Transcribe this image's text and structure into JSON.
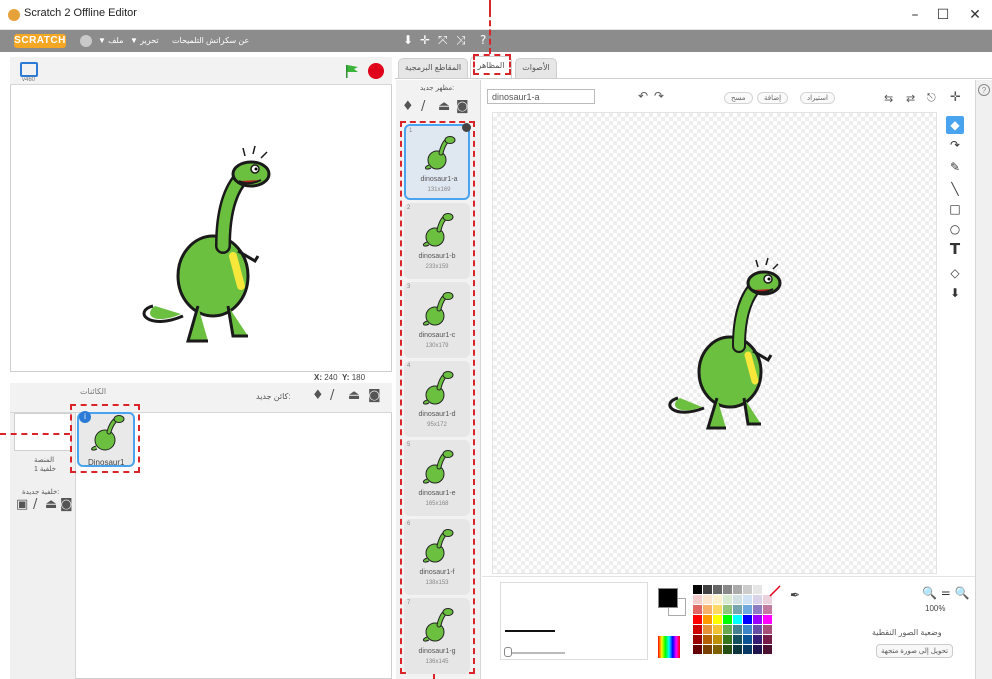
{
  "window": {
    "title": "Scratch 2 Offline Editor",
    "minimize": "–",
    "maximize": "☐",
    "close": "✕"
  },
  "menubar": {
    "logo": "SCRATCH",
    "items": [
      "▼ ملف",
      "▼ تحرير",
      "التلميحات",
      "عن سكراتش"
    ],
    "toolbar_icons": [
      "⬇",
      "✛",
      "⤧",
      "⤨",
      "?"
    ]
  },
  "stage": {
    "version": "v460",
    "coords_x": "240",
    "coords_y": "180",
    "x_label": "X:",
    "y_label": "Y:"
  },
  "sprites": {
    "title": "الكائنات",
    "new_sprite": "كائن جديد:",
    "stage_label": "المنصة",
    "backdrop_count": "خلفية 1",
    "new_backdrop": "خلفية جديدة:",
    "items": [
      {
        "name": "Dinosaur1",
        "info": "i"
      }
    ]
  },
  "tabs": [
    {
      "label": "المقاطع البرمجية",
      "active": false
    },
    {
      "label": "المظاهر",
      "active": true
    },
    {
      "label": "الأصوات",
      "active": false
    }
  ],
  "costumes": {
    "new_costume": "مظهر جديد:",
    "list": [
      {
        "num": "1",
        "name": "dinosaur1-a",
        "size": "131x169",
        "selected": true
      },
      {
        "num": "2",
        "name": "dinosaur1-b",
        "size": "233x159",
        "selected": false
      },
      {
        "num": "3",
        "name": "dinosaur1-c",
        "size": "130x179",
        "selected": false
      },
      {
        "num": "4",
        "name": "dinosaur1-d",
        "size": "95x172",
        "selected": false
      },
      {
        "num": "5",
        "name": "dinosaur1-e",
        "size": "165x168",
        "selected": false
      },
      {
        "num": "6",
        "name": "dinosaur1-f",
        "size": "138x153",
        "selected": false
      },
      {
        "num": "7",
        "name": "dinosaur1-g",
        "size": "136x145",
        "selected": false
      }
    ]
  },
  "paint": {
    "costume_name": "dinosaur1-a",
    "undo": "↶",
    "redo": "↷",
    "clear": "مسح",
    "add": "إضافة",
    "import": "استيراد",
    "zoom": "100%",
    "bitmap_mode": "وضعية الصور النقطية",
    "convert": "تحويل إلى صورة متجهة",
    "tools": [
      "◆",
      "↷",
      "✎",
      "╲",
      "□",
      "○",
      "T",
      "◇",
      "⬇"
    ],
    "top_tools": [
      "⇆",
      "⇄",
      "⎋",
      "✛"
    ]
  },
  "colors": {
    "primary": "#000000",
    "secondary": "#ffffff",
    "accent": "#4aa3ef",
    "highlight": "#d9252a",
    "palette": [
      "#000000",
      "#404040",
      "#666666",
      "#888888",
      "#aaaaaa",
      "#cccccc",
      "#e6e6e6",
      "#ffffff",
      "#f4cccc",
      "#fce5cd",
      "#fff2cc",
      "#d9ead3",
      "#d0e0e3",
      "#cfe2f3",
      "#d9d2e9",
      "#ead1dc",
      "#e06666",
      "#f6b26b",
      "#ffd966",
      "#93c47d",
      "#76a5af",
      "#6fa8dc",
      "#8e7cc3",
      "#c27ba0",
      "#ff0000",
      "#ff9900",
      "#ffff00",
      "#00ff00",
      "#00ffff",
      "#0000ff",
      "#9900ff",
      "#ff00ff",
      "#cc0000",
      "#e69138",
      "#f1c232",
      "#6aa84f",
      "#45818e",
      "#3d85c6",
      "#674ea7",
      "#a64d79",
      "#990000",
      "#b45f06",
      "#bf9000",
      "#38761d",
      "#134f5c",
      "#0b5394",
      "#351c75",
      "#741b47",
      "#660000",
      "#783f04",
      "#7f6000",
      "#274e13",
      "#0c343d",
      "#073763",
      "#20124d",
      "#4c1130"
    ]
  }
}
